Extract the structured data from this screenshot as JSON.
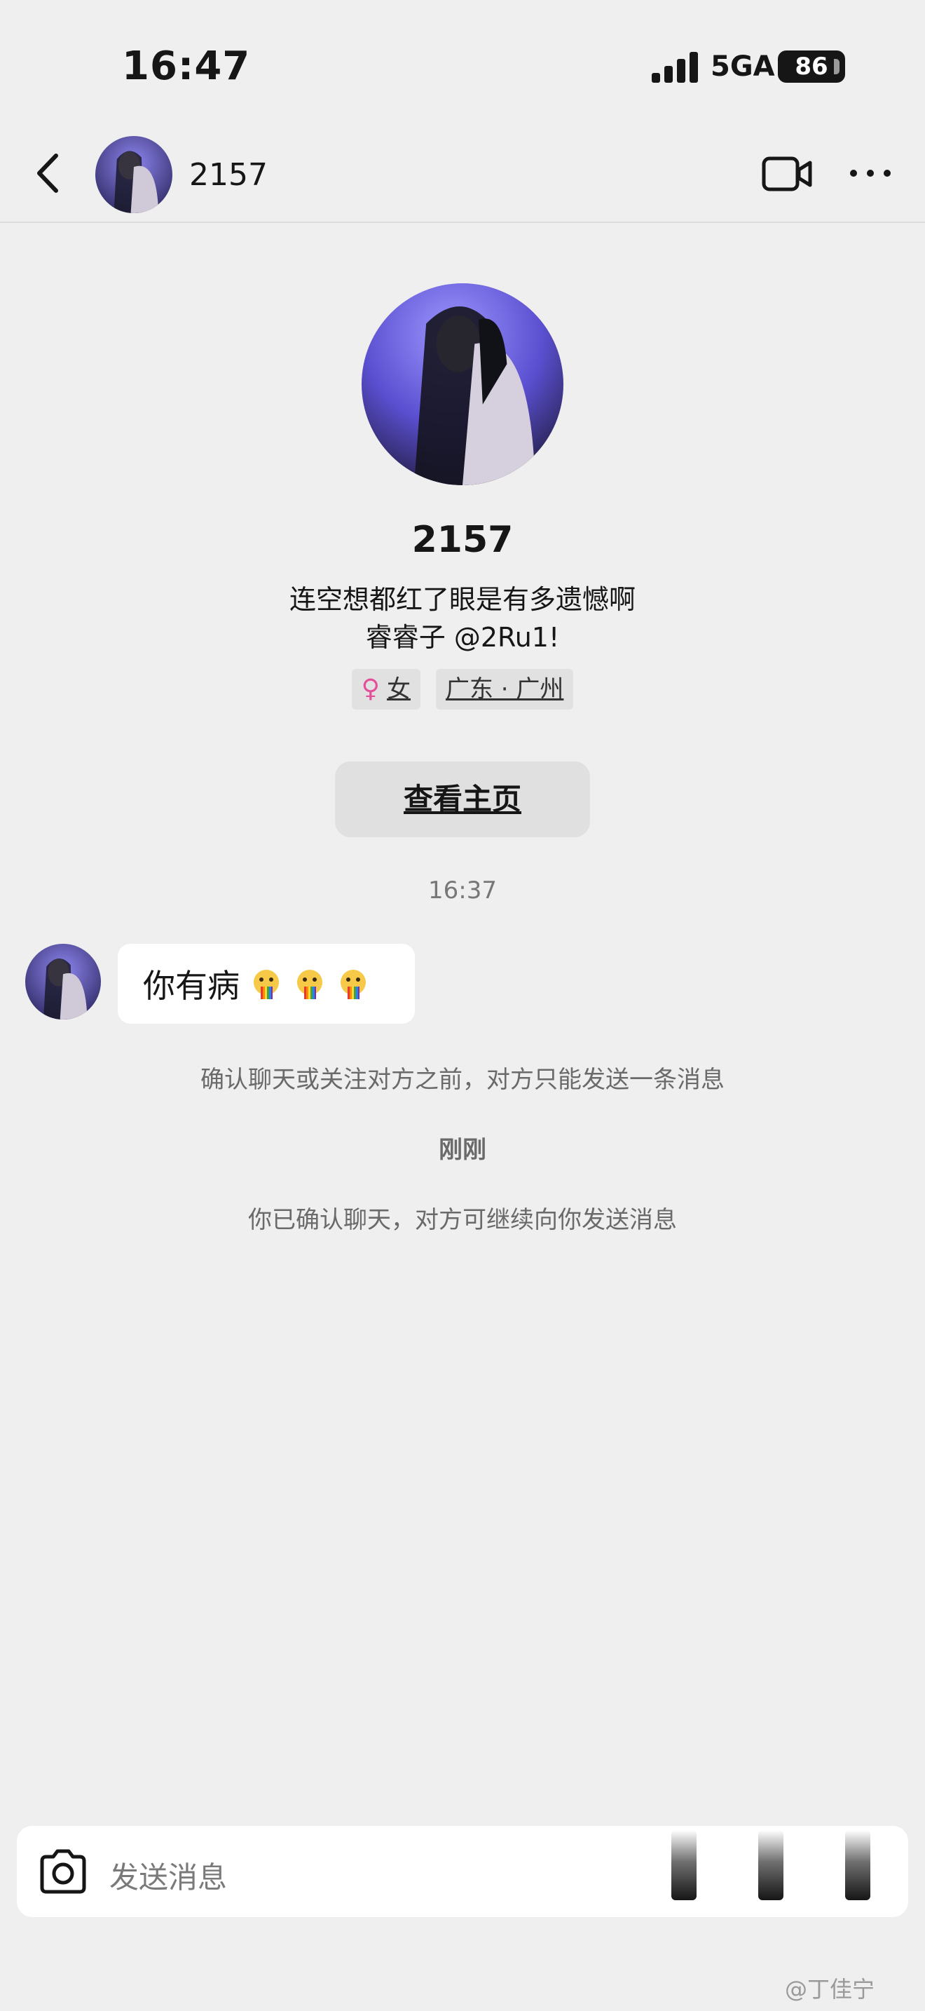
{
  "status_bar": {
    "time": "16:47",
    "network": "5GA",
    "battery": "86"
  },
  "header": {
    "name": "2157"
  },
  "profile": {
    "name": "2157",
    "bio_line1": "连空想都红了眼是有多遗憾啊",
    "bio_line2": "睿睿子 @2Ru1!",
    "gender_symbol": "♀",
    "gender": "女",
    "location": "广东 · 广州",
    "home_button": "查看主页"
  },
  "chat": {
    "time_label": "16:37",
    "message": "你有病",
    "emoji_count": 3,
    "notice_limit": "确认聊天或关注对方之前，对方只能发送一条消息",
    "time_label2": "刚刚",
    "notice_confirmed": "你已确认聊天，对方可继续向你发送消息"
  },
  "input": {
    "placeholder": "发送消息"
  },
  "watermark": "@丁佳宁",
  "colors": {
    "background": "#efefef",
    "female_pink": "#e54f9a",
    "avatar_purple": "#5a4fd0"
  }
}
